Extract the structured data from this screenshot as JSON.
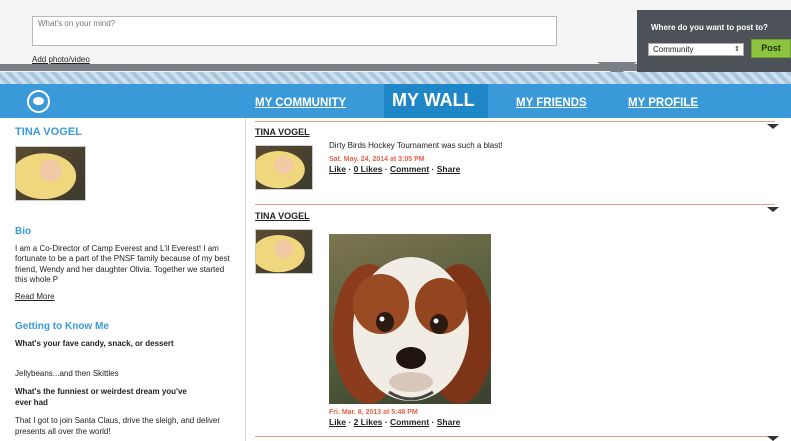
{
  "composer": {
    "placeholder": "What's on your mind?",
    "add_photo": "Add photo/video",
    "post_to_label": "Where do you want to post to?",
    "post_to_value": "Community",
    "post_button": "Post"
  },
  "nav": {
    "tabs": [
      {
        "label": "MY COMMUNITY"
      },
      {
        "label": "MY WALL"
      },
      {
        "label": "MY FRIENDS"
      },
      {
        "label": "MY PROFILE"
      }
    ]
  },
  "profile": {
    "name": "TINA VOGEL",
    "bio_heading": "Bio",
    "bio_text": "I am a Co-Director of Camp Everest and L'il Everest! I am fortunate to be a part of the PNSF family because of my best friend, Wendy and her daughter Olivia. Together we started this whole P",
    "read_more": "Read More",
    "gtk_heading": "Getting to Know Me",
    "q1": "What's your fave candy, snack, or dessert",
    "a1": "Jellybeans...and then Skittles",
    "q2": "What's the funniest or weirdest dream you've ever had",
    "a2": "That I got to join Santa Claus, drive the sleigh, and deliver presents all over the world!"
  },
  "posts": [
    {
      "author": "TINA VOGEL",
      "text": "Dirty Birds Hockey Tournament was such a blast!",
      "date": "Sat. May. 24, 2014 at 3:05 PM",
      "like": "Like",
      "likes": "0 Likes",
      "comment": "Comment",
      "share": "Share"
    },
    {
      "author": "TINA VOGEL",
      "date": "Fri. Mar. 8, 2013 at 5:48 PM",
      "like": "Like",
      "likes": "2 Likes",
      "comment": "Comment",
      "share": "Share"
    }
  ],
  "colors": {
    "nav_blue": "#3a9ad9",
    "accent_orange": "#e8614a",
    "post_green": "#8cc33f"
  }
}
